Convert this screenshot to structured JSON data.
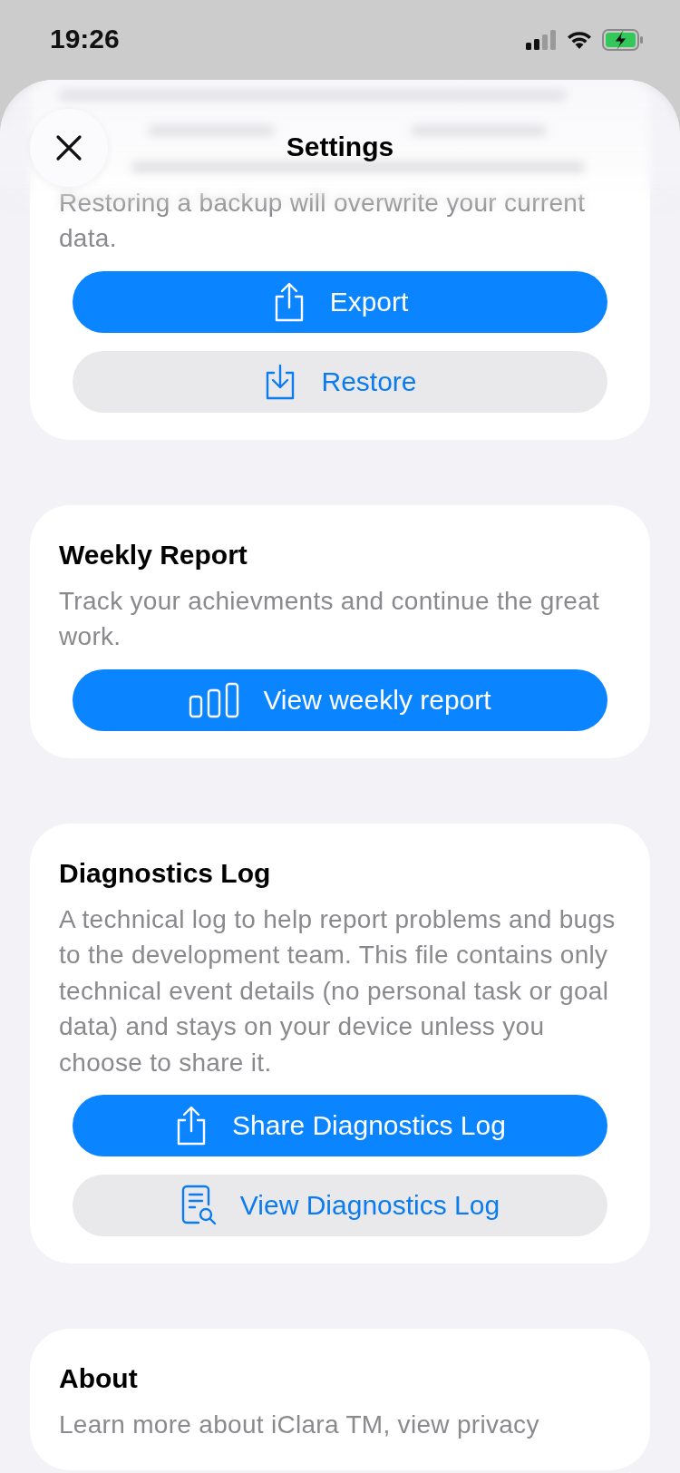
{
  "status_bar": {
    "time": "19:26"
  },
  "header": {
    "title": "Settings"
  },
  "sections": [
    {
      "description": "Restoring a backup will overwrite your current data.",
      "buttons": [
        {
          "label": "Export",
          "kind": "primary"
        },
        {
          "label": "Restore",
          "kind": "secondary"
        }
      ]
    },
    {
      "title": "Weekly Report",
      "description": "Track your achievments and continue the great work.",
      "buttons": [
        {
          "label": "View weekly report",
          "kind": "primary"
        }
      ]
    },
    {
      "title": "Diagnostics Log",
      "description": "A technical log to help report problems and bugs to the development team. This file contains only technical event details (no personal task or goal data) and stays on your device unless you choose to share it.",
      "buttons": [
        {
          "label": "Share Diagnostics Log",
          "kind": "primary"
        },
        {
          "label": "View Diagnostics Log",
          "kind": "secondary"
        }
      ]
    },
    {
      "title": "About",
      "description": "Learn more about iClara TM, view privacy"
    }
  ]
}
